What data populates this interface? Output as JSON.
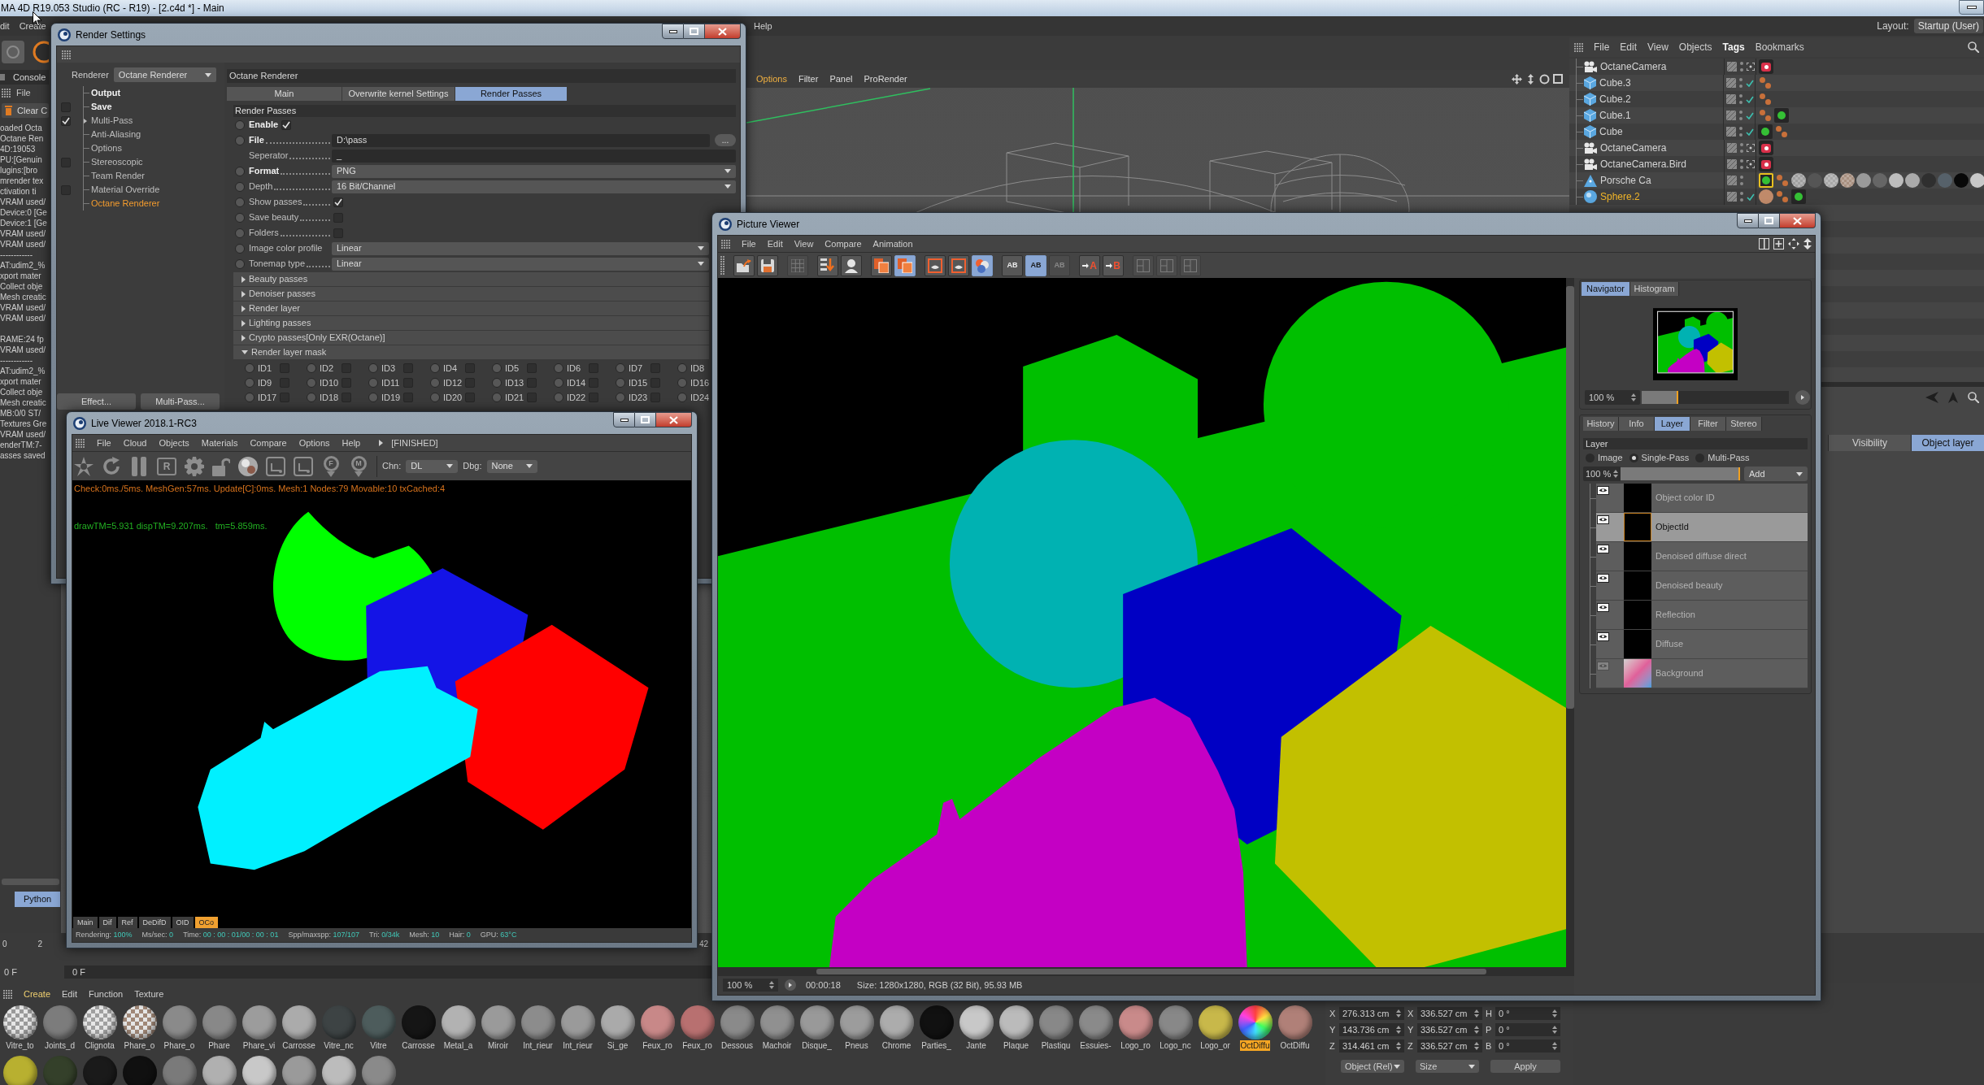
{
  "app": {
    "title": "MA 4D R19.053 Studio (RC - R19) - [2.c4d *] - Main"
  },
  "menu_left": [
    "dit",
    "Create"
  ],
  "menu_right": [
    "Help"
  ],
  "layout_selector": {
    "label": "Layout:",
    "value": "Startup (User)"
  },
  "console": {
    "tab": "Console",
    "menu": [
      "File"
    ],
    "clear_button": "Clear C",
    "log_blocks": [
      [
        "oaded Octa",
        "Octane Ren",
        "4D:19053",
        "PU:[Genuin",
        "lugins:[bro",
        "mrender tex",
        "ctivation ti",
        "VRAM used/",
        "Device:0 [Ge",
        "Device:1 [Ge",
        "VRAM used/",
        "VRAM used/",
        "------------",
        "AT:udim2_%",
        "xport mater",
        "Collect obje",
        "Mesh creatic",
        "VRAM used/",
        "VRAM used/"
      ],
      [
        "RAME:24 fp",
        "VRAM used/",
        "------------",
        "AT:udim2_%",
        "xport mater",
        "Collect obje",
        "Mesh creatic",
        "MB:0/0 ST/",
        "Textures Gre",
        "VRAM used/",
        "enderTM:7-",
        "asses saved"
      ]
    ],
    "python_tab": {
      "label": "Python",
      "selected": true
    }
  },
  "timeline": {
    "ticks": [
      "0",
      "2"
    ],
    "end_tick": "42",
    "frame_label": "0 F",
    "frame_field": "0 F"
  },
  "viewport": {
    "menu": [
      {
        "label": "Options",
        "highlighted": true
      },
      {
        "label": "Filter",
        "highlighted": false
      },
      {
        "label": "Panel",
        "highlighted": false
      },
      {
        "label": "ProRender",
        "highlighted": false
      }
    ]
  },
  "object_manager": {
    "menu": [
      {
        "label": "File",
        "selected": false
      },
      {
        "label": "Edit",
        "selected": false
      },
      {
        "label": "View",
        "selected": false
      },
      {
        "label": "Objects",
        "selected": false
      },
      {
        "label": "Tags",
        "selected": true
      },
      {
        "label": "Bookmarks",
        "selected": false
      }
    ],
    "objects": [
      {
        "name": "OctaneCamera",
        "kind": "camera",
        "selected": false,
        "tags": [
          {
            "kind": "camera",
            "selected": false
          }
        ]
      },
      {
        "name": "Cube.3",
        "kind": "cube",
        "checked": true,
        "selected": false,
        "tags": [
          {
            "kind": "material",
            "selected": false
          }
        ]
      },
      {
        "name": "Cube.2",
        "kind": "cube",
        "checked": true,
        "selected": false,
        "tags": [
          {
            "kind": "material",
            "selected": false
          }
        ]
      },
      {
        "name": "Cube.1",
        "kind": "cube",
        "checked": true,
        "selected": false,
        "tags": [
          {
            "kind": "material",
            "selected": false
          },
          {
            "kind": "octane",
            "selected": false
          }
        ]
      },
      {
        "name": "Cube",
        "kind": "cube",
        "checked": true,
        "selected": false,
        "tags": [
          {
            "kind": "octane",
            "selected": false
          },
          {
            "kind": "material",
            "selected": false
          }
        ]
      },
      {
        "name": "OctaneCamera",
        "kind": "camera",
        "selected": false,
        "tags": [
          {
            "kind": "camera",
            "selected": false
          }
        ]
      },
      {
        "name": "OctaneCamera.Bird",
        "kind": "camera",
        "selected": false,
        "tags": [
          {
            "kind": "camera",
            "selected": false
          }
        ]
      },
      {
        "name": "Porsche Ca",
        "kind": "polygon",
        "checked": false,
        "selected": false,
        "tags": [
          {
            "kind": "octane",
            "selected": true
          },
          {
            "kind": "material",
            "selected": false
          },
          {
            "kind": "checker",
            "color": "#a0a0a0",
            "selected": false
          },
          {
            "kind": "swatch",
            "color": "#555555",
            "selected": false
          },
          {
            "kind": "checker",
            "color": "#a8a8a8",
            "selected": false
          },
          {
            "kind": "checker",
            "color": "#a89080",
            "selected": false
          },
          {
            "kind": "swatch",
            "color": "#9a9a9a",
            "selected": false
          },
          {
            "kind": "swatch",
            "color": "#666666",
            "selected": false
          },
          {
            "kind": "swatch",
            "color": "#bdbdbd",
            "selected": false
          },
          {
            "kind": "swatch",
            "color": "#aaaaaa",
            "selected": false
          },
          {
            "kind": "swatch",
            "color": "#2f2f2f",
            "selected": false
          },
          {
            "kind": "swatch",
            "color": "#56616a",
            "selected": false
          },
          {
            "kind": "swatch",
            "color": "#080808",
            "selected": false
          },
          {
            "kind": "swatch",
            "color": "#c8c8c8",
            "selected": false
          }
        ]
      },
      {
        "name": "Sphere.2",
        "kind": "sphere",
        "checked": true,
        "selected": true,
        "tags": [
          {
            "kind": "swatch",
            "color": "#c08a6a",
            "selected": false
          },
          {
            "kind": "material",
            "selected": false
          },
          {
            "kind": "octane",
            "selected": false
          }
        ]
      }
    ]
  },
  "attribute_manager": {
    "tabs": [
      {
        "label": "Visibility",
        "selected": false
      },
      {
        "label": "Object layer",
        "selected": true
      }
    ]
  },
  "render_settings": {
    "title": "Render Settings",
    "renderer": {
      "label": "Renderer",
      "value": "Octane Renderer"
    },
    "tree": [
      {
        "label": "Output",
        "kind": "plain",
        "bold": true,
        "selected": false,
        "expandable": false
      },
      {
        "label": "Save",
        "kind": "checkbox",
        "checked": false,
        "bold": true,
        "selected": false,
        "expandable": false
      },
      {
        "label": "Multi-Pass",
        "kind": "checkbox",
        "checked": true,
        "bold": false,
        "selected": false,
        "expandable": true
      },
      {
        "label": "Anti-Aliasing",
        "kind": "plain",
        "bold": false,
        "selected": false,
        "expandable": false
      },
      {
        "label": "Options",
        "kind": "plain",
        "bold": false,
        "selected": false,
        "expandable": false
      },
      {
        "label": "Stereoscopic",
        "kind": "checkbox",
        "checked": false,
        "bold": false,
        "selected": false,
        "expandable": false
      },
      {
        "label": "Team Render",
        "kind": "plain",
        "bold": false,
        "selected": false,
        "expandable": false
      },
      {
        "label": "Material Override",
        "kind": "checkbox",
        "checked": false,
        "bold": false,
        "selected": false,
        "expandable": false
      },
      {
        "label": "Octane Renderer",
        "kind": "plain",
        "bold": false,
        "selected": true,
        "expandable": false
      }
    ],
    "buttons": [
      "Effect...",
      "Multi-Pass..."
    ],
    "panel_title": "Octane Renderer",
    "tabs": [
      {
        "label": "Main",
        "selected": false
      },
      {
        "label": "Overwrite kernel Settings",
        "selected": false
      },
      {
        "label": "Render Passes",
        "selected": true
      }
    ],
    "section": "Render Passes",
    "fields": [
      {
        "kind": "inline_checkbox",
        "label": "Enable",
        "checked": true,
        "bold": true,
        "animatable": true
      },
      {
        "kind": "text",
        "label": "File",
        "value": "D:\\pass",
        "button": "...",
        "bold": true,
        "animatable": true,
        "leader": true
      },
      {
        "kind": "text",
        "label": "Seperator",
        "value": "_",
        "bold": false,
        "animatable": false,
        "leader": true
      },
      {
        "kind": "dropdown",
        "label": "Format",
        "value": "PNG",
        "bold": true,
        "animatable": true,
        "leader": true
      },
      {
        "kind": "dropdown",
        "label": "Depth",
        "value": "16 Bit/Channel",
        "bold": false,
        "animatable": true,
        "leader": true
      },
      {
        "kind": "checkbox",
        "label": "Show passes",
        "checked": true,
        "bold": false,
        "animatable": true,
        "leader": true
      },
      {
        "kind": "checkbox",
        "label": "Save beauty",
        "checked": false,
        "bold": false,
        "animatable": true,
        "leader": true
      },
      {
        "kind": "checkbox",
        "label": "Folders",
        "checked": false,
        "bold": false,
        "animatable": true,
        "leader": true
      },
      {
        "kind": "dropdown",
        "label": "Image color profile",
        "value": "Linear",
        "bold": false,
        "animatable": true,
        "leader": false
      },
      {
        "kind": "dropdown",
        "label": "Tonemap type",
        "value": "Linear",
        "bold": false,
        "animatable": true,
        "leader": true
      }
    ],
    "groups": [
      {
        "label": "Beauty passes",
        "expanded": false
      },
      {
        "label": "Denoiser passes",
        "expanded": false
      },
      {
        "label": "Render layer",
        "expanded": false
      },
      {
        "label": "Lighting passes",
        "expanded": false
      },
      {
        "label": "Crypto passes[Only EXR(Octane)]",
        "expanded": false
      },
      {
        "label": "Render layer mask",
        "expanded": true
      }
    ],
    "ids": [
      {
        "label": "ID1",
        "checked": false
      },
      {
        "label": "ID2",
        "checked": false
      },
      {
        "label": "ID3",
        "checked": false
      },
      {
        "label": "ID4",
        "checked": false
      },
      {
        "label": "ID5",
        "checked": false
      },
      {
        "label": "ID6",
        "checked": false
      },
      {
        "label": "ID7",
        "checked": false
      },
      {
        "label": "ID8"
      },
      {
        "label": "ID9",
        "checked": false
      },
      {
        "label": "ID10",
        "checked": false
      },
      {
        "label": "ID11",
        "checked": false
      },
      {
        "label": "ID12",
        "checked": false
      },
      {
        "label": "ID13",
        "checked": false
      },
      {
        "label": "ID14",
        "checked": false
      },
      {
        "label": "ID15",
        "checked": false
      },
      {
        "label": "ID16"
      },
      {
        "label": "ID17",
        "checked": false
      },
      {
        "label": "ID18",
        "checked": false
      },
      {
        "label": "ID19",
        "checked": false
      },
      {
        "label": "ID20",
        "checked": false
      },
      {
        "label": "ID21",
        "checked": false
      },
      {
        "label": "ID22",
        "checked": false
      },
      {
        "label": "ID23",
        "checked": false
      },
      {
        "label": "ID24"
      }
    ]
  },
  "live_viewer": {
    "title": "Live Viewer 2018.1-RC3",
    "menu": [
      "File",
      "Cloud",
      "Objects",
      "Materials",
      "Compare",
      "Options",
      "Help"
    ],
    "state": "[FINISHED]",
    "toolbar": [
      {
        "kind": "octane"
      },
      {
        "kind": "restart"
      },
      {
        "kind": "pause"
      },
      {
        "kind": "letter",
        "label": "R"
      },
      {
        "kind": "gear"
      },
      {
        "kind": "lock"
      },
      {
        "kind": "sphere"
      },
      {
        "kind": "region"
      },
      {
        "kind": "region"
      },
      {
        "kind": "pin",
        "label": "F"
      },
      {
        "kind": "pin",
        "label": "M"
      }
    ],
    "channel": {
      "label": "Chn:",
      "value": "DL"
    },
    "debug": {
      "label": "Dbg:",
      "value": "None"
    },
    "stats_line": "Check:0ms./5ms. MeshGen:57ms. Update[C]:0ms. Mesh:1 Nodes:79 Movable:10 txCached:4",
    "timing_line": "drawTM=5.931 dispTM=9.207ms.   tm=5.859ms.",
    "channels": [
      {
        "label": "Main",
        "selected": false
      },
      {
        "label": "Dif",
        "selected": false
      },
      {
        "label": "Ref",
        "selected": false
      },
      {
        "label": "DeDifD",
        "selected": false
      },
      {
        "label": "OID",
        "selected": false
      },
      {
        "label": "OCo",
        "selected": true
      }
    ],
    "status": [
      {
        "label": "Rendering:",
        "value": "100%"
      },
      {
        "label": "Ms/sec:",
        "value": "0"
      },
      {
        "label": "Time:",
        "value": "00 : 00 : 01/00 : 00 : 01"
      },
      {
        "label": "Spp/maxspp:",
        "value": "107/107"
      },
      {
        "label": "Tri:",
        "value": "0/34k"
      },
      {
        "label": "Mesh:",
        "value": "10"
      },
      {
        "label": "Hair:",
        "value": "0"
      },
      {
        "label": "GPU:",
        "value": "63°C"
      }
    ]
  },
  "picture_viewer": {
    "title": "Picture Viewer",
    "menu": [
      "File",
      "Edit",
      "View",
      "Compare",
      "Animation"
    ],
    "toolbar": [
      [
        {
          "kind": "open",
          "selected": false,
          "disabled": false
        },
        {
          "kind": "save",
          "selected": false,
          "disabled": false
        }
      ],
      [
        {
          "kind": "grid",
          "selected": false,
          "disabled": true
        }
      ],
      [
        {
          "kind": "import",
          "selected": false,
          "disabled": false
        },
        {
          "kind": "user",
          "selected": false,
          "disabled": false
        }
      ],
      [
        {
          "kind": "copy",
          "selected": false,
          "disabled": false
        },
        {
          "kind": "stack",
          "selected": true,
          "disabled": false
        }
      ],
      [
        {
          "kind": "frame",
          "selected": false,
          "disabled": false
        },
        {
          "kind": "frame",
          "selected": false,
          "disabled": false
        },
        {
          "kind": "group",
          "selected": true,
          "disabled": false
        }
      ],
      [
        {
          "kind": "compare",
          "label": "AB",
          "selected": false,
          "disabled": false
        },
        {
          "kind": "compare",
          "label": "AB",
          "selected": true,
          "disabled": false
        },
        {
          "kind": "compare",
          "label": "AB",
          "selected": false,
          "disabled": true
        }
      ],
      [
        {
          "kind": "marker",
          "label": "A",
          "selected": false,
          "disabled": false
        },
        {
          "kind": "marker",
          "label": "B",
          "selected": false,
          "disabled": false
        }
      ],
      [
        {
          "kind": "layout",
          "selected": false,
          "disabled": true
        },
        {
          "kind": "layout",
          "selected": false,
          "disabled": true
        },
        {
          "kind": "layout",
          "selected": false,
          "disabled": true
        }
      ]
    ],
    "side_tabs": [
      {
        "label": "Navigator",
        "selected": true
      },
      {
        "label": "Histogram",
        "selected": false
      }
    ],
    "navigator_zoom": {
      "value": "100 %",
      "level": 0.25
    },
    "panel_tabs": [
      {
        "label": "History",
        "selected": false
      },
      {
        "label": "Info",
        "selected": false
      },
      {
        "label": "Layer",
        "selected": true
      },
      {
        "label": "Filter",
        "selected": false
      },
      {
        "label": "Stereo",
        "selected": false
      }
    ],
    "layer_header": "Layer",
    "layer_modes": [
      {
        "label": "Image",
        "selected": false
      },
      {
        "label": "Single-Pass",
        "selected": true
      },
      {
        "label": "Multi-Pass",
        "selected": false
      }
    ],
    "opacity": {
      "value": "100 %",
      "level": 1
    },
    "add_dropdown": "Add",
    "layers": [
      {
        "name": "Object color ID",
        "kind": "pass",
        "visible": true,
        "selected": false
      },
      {
        "name": "ObjectId",
        "kind": "pass",
        "visible": true,
        "selected": true
      },
      {
        "name": "Denoised diffuse direct",
        "kind": "pass",
        "visible": true,
        "selected": false
      },
      {
        "name": "Denoised beauty",
        "kind": "pass",
        "visible": true,
        "selected": false
      },
      {
        "name": "Reflection",
        "kind": "pass",
        "visible": true,
        "selected": false
      },
      {
        "name": "Diffuse",
        "kind": "pass",
        "visible": true,
        "selected": false
      },
      {
        "name": "Background",
        "kind": "image",
        "visible": false,
        "selected": false
      }
    ],
    "status": {
      "zoom": "100 %",
      "time": "00:00:18",
      "info": "Size: 1280x1280, RGB (32 Bit), 95.93 MB"
    }
  },
  "material_manager": {
    "menu": [
      {
        "label": "Create",
        "highlighted": true
      },
      {
        "label": "Edit",
        "highlighted": false
      },
      {
        "label": "Function",
        "highlighted": false
      },
      {
        "label": "Texture",
        "highlighted": false
      }
    ],
    "materials": [
      {
        "name": "Vitre_to",
        "kind": "checker",
        "color": "#9a9a9a",
        "selected": false
      },
      {
        "name": "Joints_d",
        "kind": "ball",
        "color": "#7c7c7c",
        "selected": false
      },
      {
        "name": "Clignota",
        "kind": "checker",
        "color": "#a0a0a0",
        "selected": false
      },
      {
        "name": "Phare_o",
        "kind": "checker",
        "color": "#a08878",
        "selected": false
      },
      {
        "name": "Phare_o",
        "kind": "ball",
        "color": "#8a8a8a",
        "selected": false
      },
      {
        "name": "Phare",
        "kind": "ball",
        "color": "#888888",
        "selected": false
      },
      {
        "name": "Phare_vi",
        "kind": "ball",
        "color": "#9c9c9c",
        "selected": false
      },
      {
        "name": "Carrosse",
        "kind": "ball",
        "color": "#ababab",
        "selected": false
      },
      {
        "name": "Vitre_nc",
        "kind": "ball",
        "color": "#3d4344",
        "selected": false
      },
      {
        "name": "Vitre",
        "kind": "ball",
        "color": "#4d5c5c",
        "selected": false
      },
      {
        "name": "Carrosse",
        "kind": "ball",
        "color": "#151515",
        "selected": false
      },
      {
        "name": "Metal_a",
        "kind": "ball",
        "color": "#b2b2b2",
        "selected": false
      },
      {
        "name": "Miroir",
        "kind": "ball",
        "color": "#9a9a9a",
        "selected": false
      },
      {
        "name": "Int_rieur",
        "kind": "ball",
        "color": "#8c8c8c",
        "selected": false
      },
      {
        "name": "Int_rieur",
        "kind": "ball",
        "color": "#9a9a9a",
        "selected": false
      },
      {
        "name": "Si_ge",
        "kind": "ball",
        "color": "#aaaaaa",
        "selected": false
      },
      {
        "name": "Feux_ro",
        "kind": "ball",
        "color": "#c88888",
        "selected": false
      },
      {
        "name": "Feux_ro",
        "kind": "ball",
        "color": "#b87070",
        "selected": false
      },
      {
        "name": "Dessous",
        "kind": "ball",
        "color": "#8a8a8a",
        "selected": false
      },
      {
        "name": "Machoir",
        "kind": "ball",
        "color": "#909090",
        "selected": false
      },
      {
        "name": "Disque_",
        "kind": "ball",
        "color": "#999999",
        "selected": false
      },
      {
        "name": "Pneus",
        "kind": "ball",
        "color": "#9c9c9c",
        "selected": false
      },
      {
        "name": "Chrome",
        "kind": "ball",
        "color": "#acacac",
        "selected": false
      },
      {
        "name": "Parties_",
        "kind": "ball",
        "color": "#111111",
        "selected": false
      },
      {
        "name": "Jante",
        "kind": "ball",
        "color": "#c8c8c8",
        "selected": false
      },
      {
        "name": "Plaque",
        "kind": "ball",
        "color": "#bbbbbb",
        "selected": false
      },
      {
        "name": "Plastiqu",
        "kind": "ball",
        "color": "#888888",
        "selected": false
      },
      {
        "name": "Essuies-",
        "kind": "ball",
        "color": "#8a8a8a",
        "selected": false
      },
      {
        "name": "Logo_ro",
        "kind": "ball",
        "color": "#c98a8a",
        "selected": false
      },
      {
        "name": "Logo_nc",
        "kind": "ball",
        "color": "#888888",
        "selected": false
      },
      {
        "name": "Logo_or",
        "kind": "ball",
        "color": "#c8b84a",
        "selected": false
      },
      {
        "name": "OctDiffu",
        "kind": "multicolor",
        "selected": true
      },
      {
        "name": "OctDiffu",
        "kind": "ball",
        "color": "#b08078",
        "selected": false
      }
    ],
    "second_row": [
      {
        "kind": "ball",
        "color": "#b8b030"
      },
      {
        "kind": "ball",
        "color": "#34402a"
      },
      {
        "kind": "ball",
        "color": "#1a1a1a"
      },
      {
        "kind": "ball",
        "color": "#101010"
      },
      {
        "kind": "ball",
        "color": "#7a7a7a"
      },
      {
        "kind": "ball",
        "color": "#b0b0b0"
      },
      {
        "kind": "ball",
        "color": "#c8c8c8"
      },
      {
        "kind": "ball",
        "color": "#9a9a9a"
      },
      {
        "kind": "ball",
        "color": "#bcbcbc"
      },
      {
        "kind": "ball",
        "color": "#8a8a8a"
      }
    ]
  },
  "coordinates": {
    "rows": [
      {
        "position": {
          "axis": "X",
          "value": "276.313 cm"
        },
        "size": {
          "axis": "X",
          "value": "336.527 cm"
        },
        "rotation": {
          "axis": "H",
          "value": "0 °"
        }
      },
      {
        "position": {
          "axis": "Y",
          "value": "143.736 cm"
        },
        "size": {
          "axis": "Y",
          "value": "336.527 cm"
        },
        "rotation": {
          "axis": "P",
          "value": "0 °"
        }
      },
      {
        "position": {
          "axis": "Z",
          "value": "314.461 cm"
        },
        "size": {
          "axis": "Z",
          "value": "336.527 cm"
        },
        "rotation": {
          "axis": "B",
          "value": "0 °"
        }
      }
    ],
    "mode": "Object (Rel)",
    "size_mode": "Size",
    "apply_button": "Apply"
  }
}
